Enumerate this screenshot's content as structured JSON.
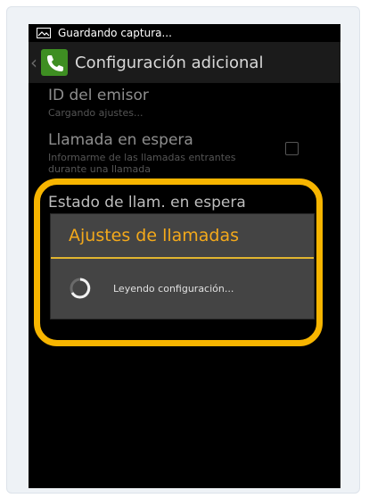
{
  "status_bar": {
    "text": "Guardando captura...",
    "icon": "screenshot-icon"
  },
  "action_bar": {
    "title": "Configuración adicional",
    "app_icon": "phone-icon"
  },
  "prefs": [
    {
      "title": "ID del emisor",
      "summary": "Cargando ajustes..."
    },
    {
      "title": "Llamada en espera",
      "summary": "Informarme de las llamadas entrantes durante una llamada"
    },
    {
      "title": "Estado de llam. en espera"
    }
  ],
  "dialog": {
    "title": "Ajustes de llamadas",
    "message": "Leyendo configuración..."
  },
  "colors": {
    "accent": "#f3a91b",
    "highlight": "#f7b500",
    "divider": "#e1b530"
  }
}
